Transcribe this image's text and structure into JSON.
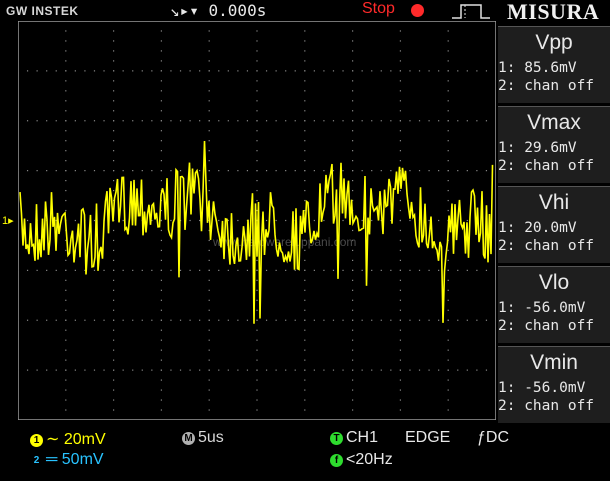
{
  "header": {
    "logo": "GW INSTEK",
    "trigger_position": "↘▸▾ 0.000s",
    "run_status": "Stop",
    "brand": "MISURA"
  },
  "screen": {
    "ch1_marker": "1▸",
    "watermark": "www.hardwareluppani.com"
  },
  "measurements": [
    {
      "title": "Vpp",
      "ch1": "1: 85.6mV",
      "ch2": "2: chan off"
    },
    {
      "title": "Vmax",
      "ch1": "1: 29.6mV",
      "ch2": "2: chan off"
    },
    {
      "title": "Vhi",
      "ch1": "1: 20.0mV",
      "ch2": "2: chan off"
    },
    {
      "title": "Vlo",
      "ch1": "1: -56.0mV",
      "ch2": "2: chan off"
    },
    {
      "title": "Vmin",
      "ch1": "1: -56.0mV",
      "ch2": "2: chan off"
    }
  ],
  "footer": {
    "ch1_badge": "1",
    "ch1_scale": "∼ 20mV",
    "ch2_badge": "2",
    "ch2_scale": "═ 50mV",
    "m_badge": "M",
    "timebase": "5us",
    "t_badge": "T",
    "trig_source": "CH1",
    "trig_type": "EDGE",
    "trig_slope": "ƒDC",
    "f_badge": "f",
    "frequency": "<20Hz"
  },
  "colors": {
    "ch1": "#ffff00",
    "ch2": "#29c3ff",
    "green": "#2edc2e",
    "stop": "#ff2a2a"
  }
}
